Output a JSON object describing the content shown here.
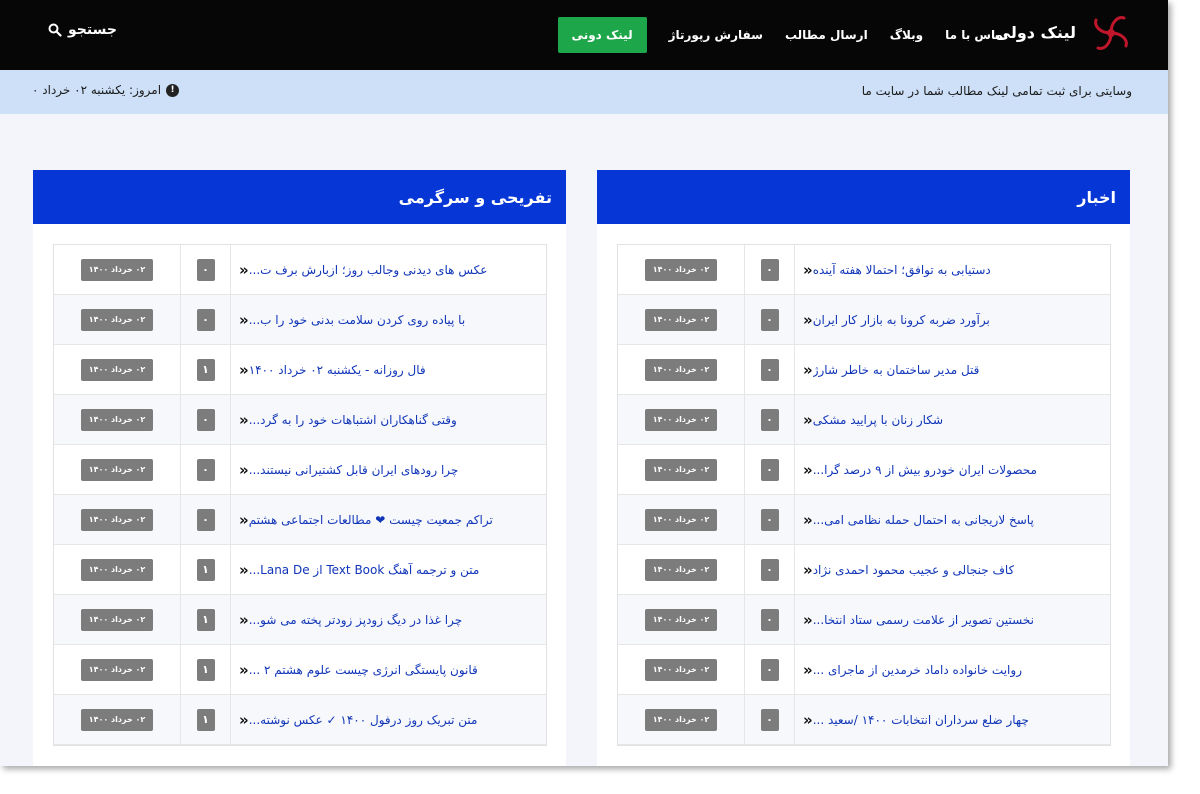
{
  "header": {
    "brand": "لینک دولی",
    "nav": [
      {
        "label": "لینک دونی",
        "active": true
      },
      {
        "label": "سفارش رپورتاژ"
      },
      {
        "label": "ارسال مطالب"
      },
      {
        "label": "وبلاگ"
      },
      {
        "label": "تماس با ما"
      }
    ],
    "search_label": "جستجو",
    "logo_color": "#c0162c"
  },
  "infobar": {
    "tagline": "وسایتی برای ثبت تمامی لینک مطالب شما در سایت ما",
    "today": "امروز: یکشنبه ۰۲ خرداد ۰"
  },
  "sections": {
    "news": {
      "title": "اخبار",
      "items": [
        {
          "title": "دستیابی به توافق؛ احتمالا هفته آینده",
          "count": "۰",
          "date": "۰۲ خرداد ۱۴۰۰"
        },
        {
          "title": "برآورد ضربه کرونا به بازار کار ایران",
          "count": "۰",
          "date": "۰۲ خرداد ۱۴۰۰"
        },
        {
          "title": "قتل مدیر ساختمان به خاطر شارژ",
          "count": "۰",
          "date": "۰۲ خرداد ۱۴۰۰"
        },
        {
          "title": "شکار زنان با پرایید مشکی",
          "count": "۰",
          "date": "۰۲ خرداد ۱۴۰۰"
        },
        {
          "title": "محصولات ایران خودرو بیش از ۹ درصد گرا...",
          "count": "۰",
          "date": "۰۲ خرداد ۱۴۰۰"
        },
        {
          "title": "پاسخ لاریجانی به احتمال حمله نظامی امی...",
          "count": "۰",
          "date": "۰۲ خرداد ۱۴۰۰"
        },
        {
          "title": "کاف جنجالی و عجیب محمود احمدی نژاد",
          "count": "۰",
          "date": "۰۲ خرداد ۱۴۰۰"
        },
        {
          "title": "نخستین تصویر از علامت رسمی ستاد انتخا...",
          "count": "۰",
          "date": "۰۲ خرداد ۱۴۰۰"
        },
        {
          "title": "روایت خانواده داماد خرمدین از ماجرای ...",
          "count": "۰",
          "date": "۰۲ خرداد ۱۴۰۰"
        },
        {
          "title": "چهار ضلع سرداران انتخابات ۱۴۰۰ /سعید ...",
          "count": "۰",
          "date": "۰۲ خرداد ۱۴۰۰"
        }
      ]
    },
    "fun": {
      "title": "تفریحی و سرگرمی",
      "items": [
        {
          "title": "عکس های دیدنی وجالب روز؛ ازبارش برف ت...",
          "count": "۰",
          "date": "۰۲ خرداد ۱۴۰۰"
        },
        {
          "title": "با پیاده روی کردن سلامت بدنی خود را ب...",
          "count": "۰",
          "date": "۰۲ خرداد ۱۴۰۰"
        },
        {
          "title": "فال روزانه - یکشنبه ۰۲ خرداد ۱۴۰۰",
          "count": "۱",
          "date": "۰۲ خرداد ۱۴۰۰"
        },
        {
          "title": "وقتی گناهکاران اشتباهات خود را به گرد...",
          "count": "۰",
          "date": "۰۲ خرداد ۱۴۰۰"
        },
        {
          "title": "چرا رودهای ایران قابل کشتیرانی نیستند...",
          "count": "۰",
          "date": "۰۲ خرداد ۱۴۰۰"
        },
        {
          "title": "تراکم جمعیت چیست ❤ مطالعات اجتماعی هشتم",
          "count": "۰",
          "date": "۰۲ خرداد ۱۴۰۰"
        },
        {
          "title": "متن و ترجمه آهنگ Text Book از Lana De...",
          "count": "۱",
          "date": "۰۲ خرداد ۱۴۰۰"
        },
        {
          "title": "چرا غذا در دیگ زودپز زودتر پخته می شو...",
          "count": "۱",
          "date": "۰۲ خرداد ۱۴۰۰"
        },
        {
          "title": "قانون پایستگی انرژی چیست علوم هشتم ۲ ...",
          "count": "۱",
          "date": "۰۲ خرداد ۱۴۰۰"
        },
        {
          "title": "متن تبریک روز درفول ۱۴۰۰ ✓ عکس نوشته...",
          "count": "۱",
          "date": "۰۲ خرداد ۱۴۰۰"
        }
      ]
    }
  }
}
